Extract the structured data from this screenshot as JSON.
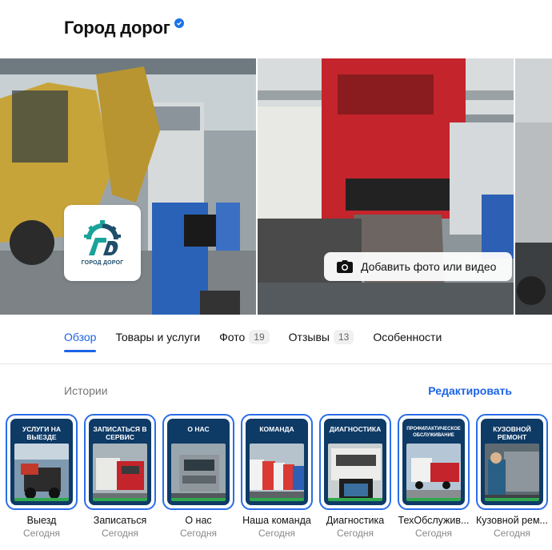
{
  "header": {
    "title": "Город дорог",
    "verified_icon": "verified-check-icon"
  },
  "logo": {
    "text": "ГОРОД ДОРОГ",
    "color_teal": "#1aa39a",
    "color_dark": "#1f4e6b"
  },
  "gallery": {
    "add_button_label": "Добавить фото или видео",
    "add_icon": "camera-icon"
  },
  "tabs": [
    {
      "label": "Обзор",
      "count": ""
    },
    {
      "label": "Товары и услуги",
      "count": ""
    },
    {
      "label": "Фото",
      "count": "19"
    },
    {
      "label": "Отзывы",
      "count": "13"
    },
    {
      "label": "Особенности",
      "count": ""
    }
  ],
  "stories_section": {
    "label": "Истории",
    "edit_label": "Редактировать"
  },
  "stories": [
    {
      "banner": "УСЛУГИ НА ВЫЕЗДЕ",
      "name": "Выезд",
      "date": "Сегодня"
    },
    {
      "banner": "ЗАПИСАТЬСЯ В СЕРВИС",
      "name": "Записаться",
      "date": "Сегодня"
    },
    {
      "banner": "О НАС",
      "name": "О нас",
      "date": "Сегодня"
    },
    {
      "banner": "КОМАНДА",
      "name": "Наша команда",
      "date": "Сегодня"
    },
    {
      "banner": "ДИАГНОСТИКА",
      "name": "Диагностика",
      "date": "Сегодня"
    },
    {
      "banner": "ПРОФИЛАКТИЧЕСКОЕ ОБСЛУЖИВАНИЕ",
      "name": "ТехОбслужив...",
      "date": "Сегодня"
    },
    {
      "banner": "КУЗОВНОЙ РЕМОНТ",
      "name": "Кузовной рем...",
      "date": "Сегодня"
    }
  ],
  "colors": {
    "accent": "#1d63e6",
    "story_ring": "#2a6de9",
    "story_bg": "#0e3a66"
  }
}
